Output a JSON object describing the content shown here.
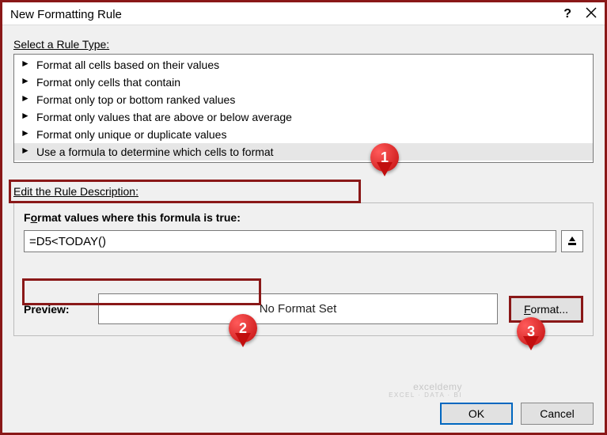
{
  "dialog": {
    "title": "New Formatting Rule",
    "help_tooltip": "?"
  },
  "select_rule": {
    "label": "Select a Rule Type:",
    "items": [
      "Format all cells based on their values",
      "Format only cells that contain",
      "Format only top or bottom ranked values",
      "Format only values that are above or below average",
      "Format only unique or duplicate values",
      "Use a formula to determine which cells to format"
    ],
    "selected_index": 5
  },
  "edit_desc": {
    "label": "Edit the Rule Description:",
    "formula_label": "Format values where this formula is true:",
    "formula_value": "=D5<TODAY()"
  },
  "preview": {
    "label": "Preview:",
    "value": "No Format Set",
    "format_button": "Format..."
  },
  "footer": {
    "ok": "OK",
    "cancel": "Cancel"
  },
  "callouts": {
    "one": "1",
    "two": "2",
    "three": "3"
  },
  "watermark": {
    "brand": "exceldemy",
    "sub": "EXCEL · DATA · BI"
  }
}
